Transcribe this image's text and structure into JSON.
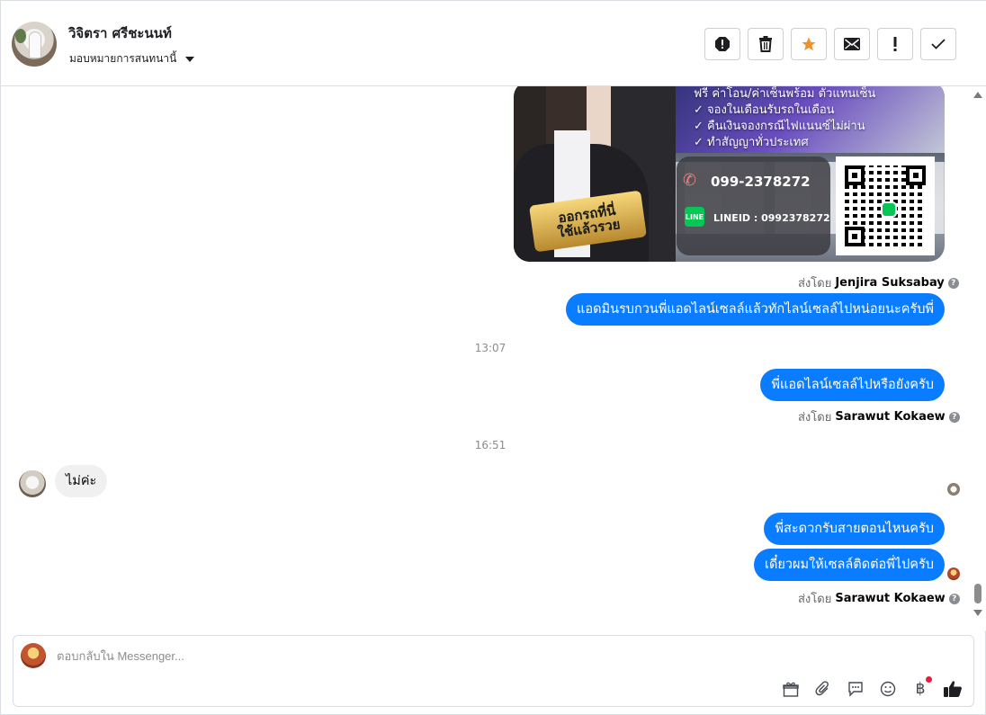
{
  "header": {
    "contact_name": "วิจิตรา ศรีชะนนท์",
    "assign_label": "มอบหมายการสนทนานี้"
  },
  "toolbar": {
    "buttons": [
      {
        "name": "spam",
        "glyph": "!"
      },
      {
        "name": "delete",
        "glyph": "🗑"
      },
      {
        "name": "star",
        "glyph": "★"
      },
      {
        "name": "mark-unread",
        "glyph": "✉"
      },
      {
        "name": "follow-up",
        "glyph": "!"
      },
      {
        "name": "done",
        "glyph": "✓"
      }
    ]
  },
  "image_message": {
    "features": [
      "ฟรี ค่าโอน/ค่าเซ็นพร้อม ตัวแทนเซ็น",
      "✓ จองในเดือนรับรถในเดือน",
      "✓ คืนเงินจองกรณีไฟแนนซ์ไม่ผ่าน",
      "✓ ทำสัญญาทั่วประเทศ"
    ],
    "phone": "099-2378272",
    "line_id": "LINEID : 0992378272",
    "line_icon": "LINE",
    "banner": "ออกรถที่นี่\nใช้แล้วรวย"
  },
  "messages": {
    "sent_by_prefix": "ส่งโดย",
    "sent_by_1": "Jenjira Suksabay",
    "msg_1": "แอดมินรบกวนพี่แอดไลน์เซลล์แล้วทักไลน์เซลล์ไปหน่อยนะครับพี่",
    "time_1": "13:07",
    "msg_2": "พี่แอดไลน์เซลล์ไปหรือยังครับ",
    "sent_by_2": "Sarawut Kokaew",
    "time_2": "16:51",
    "msg_3": "ไม่ค่ะ",
    "msg_4": "พี่สะดวกรับสายตอนไหนครับ",
    "msg_5": "เดี๋ยวผมให้เซลล์ติดต่อพี่ไปครับ",
    "sent_by_3": "Sarawut Kokaew"
  },
  "composer": {
    "placeholder": "ตอบกลับใน Messenger...",
    "tools": [
      "gift-icon",
      "attachment-icon",
      "saved-replies-icon",
      "emoji-icon",
      "baht-icon",
      "like-icon"
    ],
    "baht_glyph": "฿"
  },
  "colors": {
    "outgoing_bubble": "#0a7cff",
    "incoming_bubble": "#f0f0f0",
    "star": "#f0902a",
    "notification_dot": "#e41e3f"
  }
}
